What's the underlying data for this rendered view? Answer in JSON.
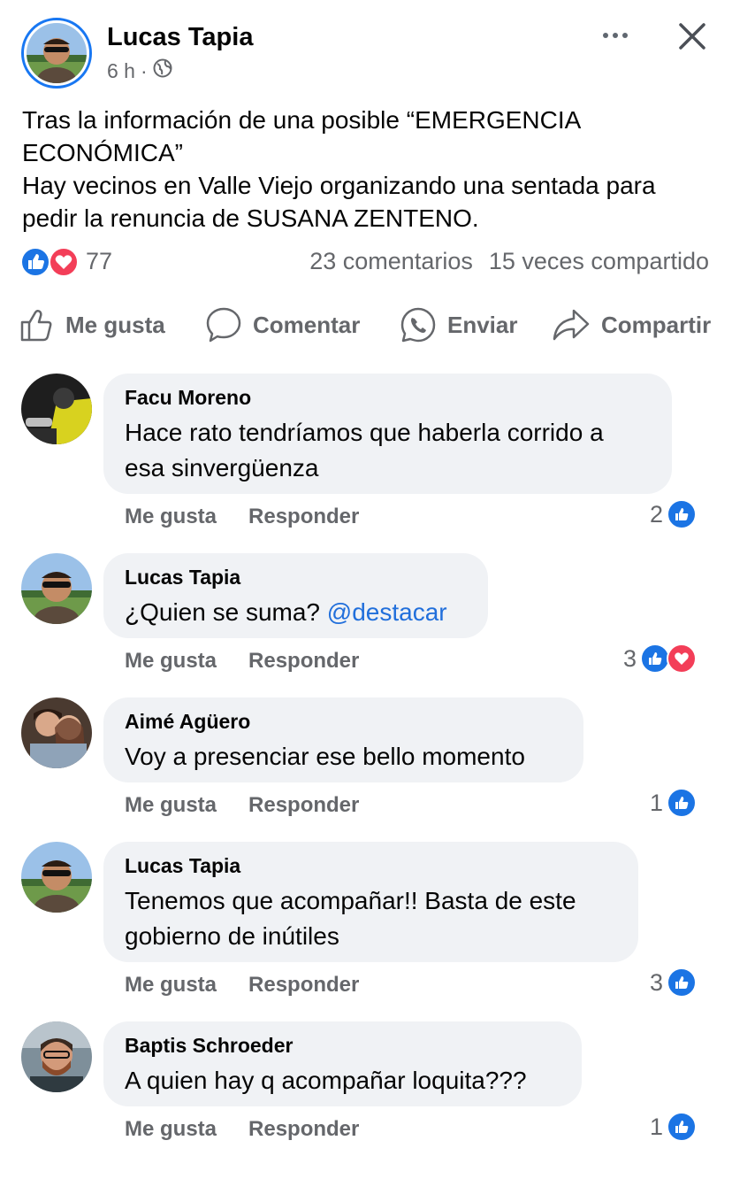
{
  "post": {
    "author": "Lucas Tapia",
    "time": "6 h",
    "separator": "·",
    "privacy_icon": "globe-icon",
    "text_lines": [
      "Tras la información de una posible “EMERGENCIA",
      "ECONÓMICA”",
      "Hay vecinos en Valle Viejo organizando una sentada para",
      "pedir la renuncia de SUSANA ZENTENO."
    ],
    "reactions_count": "77",
    "comments_count": "23 comentarios",
    "shares_count": "15 veces compartido"
  },
  "actions": {
    "like": "Me gusta",
    "comment": "Comentar",
    "send": "Enviar",
    "share": "Compartir"
  },
  "comments": [
    {
      "name": "Facu Moreno",
      "lines": [
        "Hace rato tendríamos que haberla corrido a",
        "esa sinvergüenza"
      ],
      "like": "Me gusta",
      "reply": "Responder",
      "reaction_count": "2",
      "reactions": [
        "like"
      ]
    },
    {
      "name": "Lucas Tapia",
      "text_before": "¿Quien se suma? ",
      "mention": "@destacar",
      "like": "Me gusta",
      "reply": "Responder",
      "reaction_count": "3",
      "reactions": [
        "like",
        "love"
      ]
    },
    {
      "name": "Aimé Agüero",
      "lines": [
        "Voy a presenciar ese bello momento"
      ],
      "like": "Me gusta",
      "reply": "Responder",
      "reaction_count": "1",
      "reactions": [
        "like"
      ]
    },
    {
      "name": "Lucas Tapia",
      "lines": [
        "Tenemos que acompañar!! Basta de este",
        "gobierno de inútiles"
      ],
      "like": "Me gusta",
      "reply": "Responder",
      "reaction_count": "3",
      "reactions": [
        "like"
      ]
    },
    {
      "name": "Baptis Schroeder",
      "lines": [
        "A quien hay q acompañar loquita???"
      ],
      "like": "Me gusta",
      "reply": "Responder",
      "reaction_count": "1",
      "reactions": [
        "like"
      ]
    }
  ],
  "colors": {
    "accent": "#1877f2",
    "like": "#1b74e4",
    "love": "#f33e58",
    "muted": "#65676b",
    "bubble": "#f0f2f5",
    "mention": "#216fdb"
  }
}
